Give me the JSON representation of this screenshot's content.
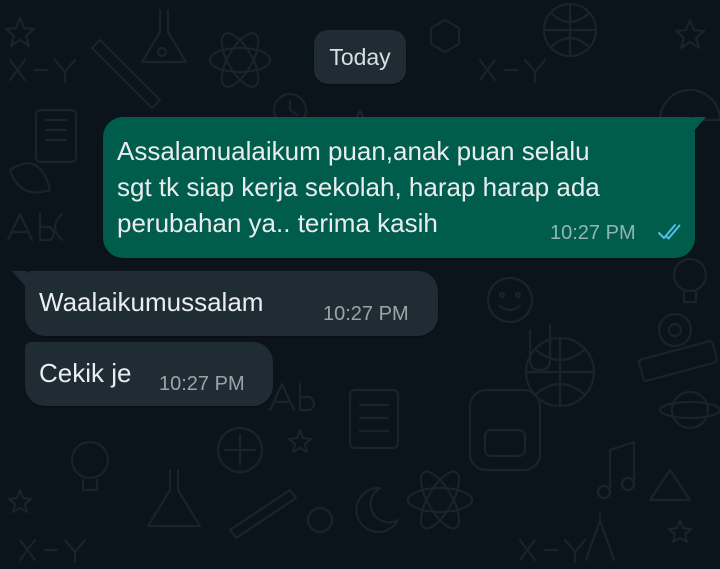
{
  "date_divider": {
    "label": "Today"
  },
  "messages": [
    {
      "direction": "outgoing",
      "text": "Assalamualaikum puan,anak puan selalu\nsgt tk siap kerja sekolah, harap harap ada\nperubahan ya.. terima kasih",
      "time": "10:27 PM",
      "status": "read",
      "status_icon": "double-check-icon"
    },
    {
      "direction": "incoming",
      "text": "Waalaikumussalam",
      "time": "10:27 PM"
    },
    {
      "direction": "incoming",
      "text": "Cekik je",
      "time": "10:27 PM"
    }
  ],
  "colors": {
    "background": "#0b141a",
    "outgoing_bubble": "#005c4b",
    "incoming_bubble": "#1f2c34",
    "text": "#e9edef",
    "read_ticks": "#53bdeb"
  }
}
